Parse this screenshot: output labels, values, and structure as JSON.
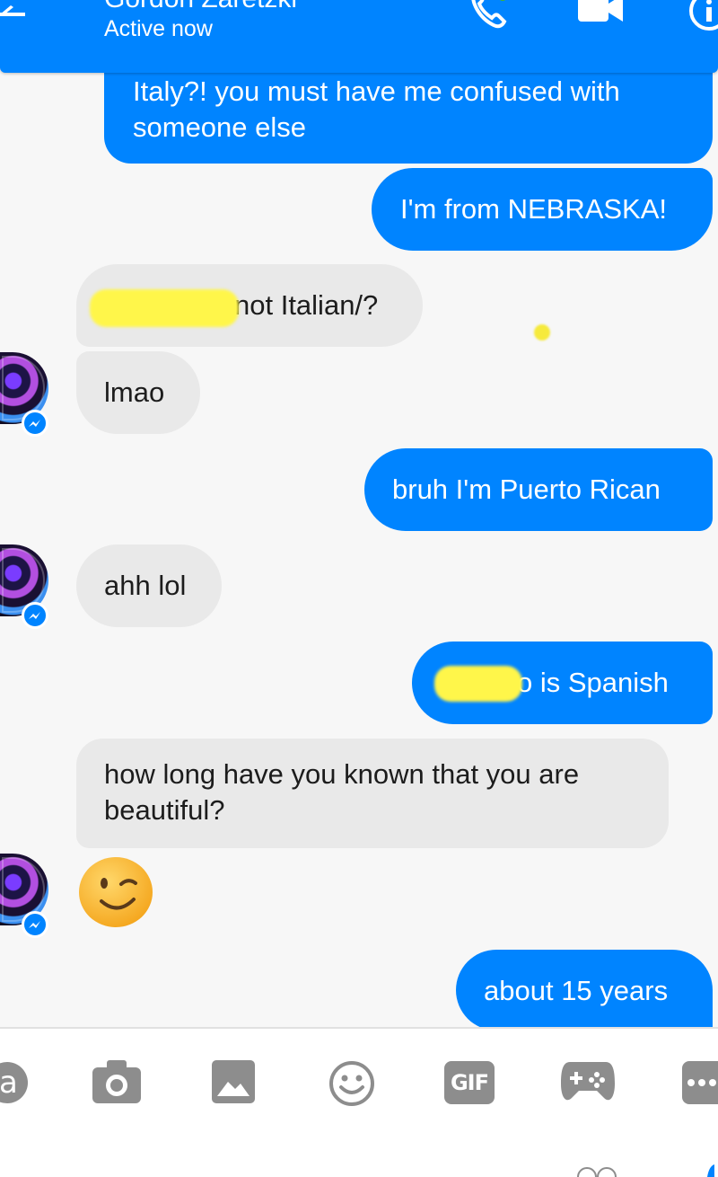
{
  "header": {
    "contact_name": "Gordon Zaretzki",
    "status": "Active now",
    "accent_color": "#0084ff",
    "icons": [
      "back-arrow-icon",
      "phone-icon",
      "video-camera-icon",
      "info-icon"
    ]
  },
  "messages": [
    {
      "direction": "out",
      "lines": [
        "Italy?! you must have me confused with",
        "someone else"
      ]
    },
    {
      "direction": "out",
      "lines": [
        "I'm from NEBRASKA!"
      ]
    },
    {
      "direction": "in",
      "lines": [
        "not Italian/?"
      ],
      "redacted": true
    },
    {
      "direction": "in",
      "lines": [
        "lmao"
      ]
    },
    {
      "direction": "out",
      "lines": [
        "bruh I'm Puerto Rican"
      ]
    },
    {
      "direction": "in",
      "lines": [
        "ahh lol"
      ]
    },
    {
      "direction": "out",
      "lines": [
        "o is Spanish"
      ],
      "redacted": true
    },
    {
      "direction": "in",
      "lines": [
        "how long have you known that you are",
        "beautiful?"
      ]
    },
    {
      "direction": "in",
      "emoji": "winking-face"
    },
    {
      "direction": "out",
      "lines": [
        "about 15 years"
      ]
    }
  ],
  "composer": {
    "tools": [
      "aa-text-icon",
      "camera-icon",
      "gallery-icon",
      "emoji-icon",
      "gif-icon",
      "games-icon",
      "more-icon"
    ],
    "gif_label": "GIF",
    "text_tool_label": "a"
  },
  "colors": {
    "outgoing_bubble": "#0084ff",
    "incoming_bubble": "#e9e9e9",
    "background": "#f7f7f7",
    "tool_gray": "#8d8d8d"
  }
}
